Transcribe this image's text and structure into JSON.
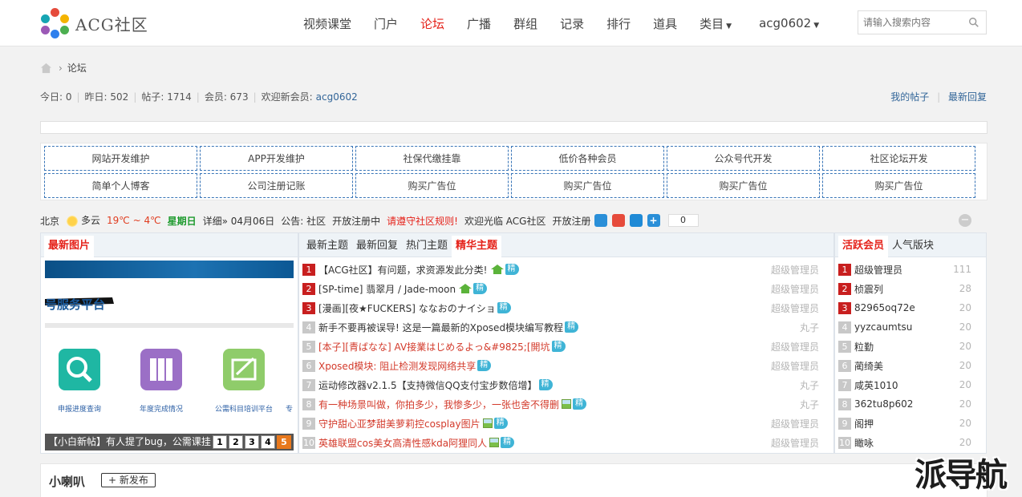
{
  "header": {
    "brand": "ACG社区",
    "nav": [
      {
        "label": "视频课堂",
        "active": false
      },
      {
        "label": "门户",
        "active": false
      },
      {
        "label": "论坛",
        "active": true
      },
      {
        "label": "广播",
        "active": false
      },
      {
        "label": "群组",
        "active": false
      },
      {
        "label": "记录",
        "active": false
      },
      {
        "label": "排行",
        "active": false
      },
      {
        "label": "道具",
        "active": false
      }
    ],
    "category_label": "类目",
    "user_label": "acg0602",
    "search_placeholder": "请输入搜索内容"
  },
  "breadcrumb": {
    "current": "论坛"
  },
  "stats": {
    "today": "今日: 0",
    "yesterday": "昨日: 502",
    "posts": "帖子: 1714",
    "members": "会员: 673",
    "welcome_prefix": "欢迎新会员:",
    "new_member": "acg0602",
    "my_posts": "我的帖子",
    "latest_replies": "最新回复"
  },
  "ads": [
    "网站开发维护",
    "APP开发维护",
    "社保代缴挂靠",
    "低价各种会员",
    "公众号代开发",
    "社区论坛开发",
    "简单个人博客",
    "公司注册记账",
    "购买广告位",
    "购买广告位",
    "购买广告位",
    "购买广告位"
  ],
  "strip": {
    "city": "北京",
    "weather": "多云",
    "temp": "19℃ ~ 4℃",
    "weekday": "星期日",
    "detail": "详细» 04月06日",
    "notice_label": "公告: 社区",
    "notice_1": "开放注册中",
    "notice_2": "请遵守社区规则!",
    "notice_3": "欢迎光临 ACG社区",
    "notice_4": "开放注册",
    "count": "0",
    "collapse": "−"
  },
  "left_panel": {
    "tab": "最新图片",
    "slide_text": "号服务平台",
    "apps": [
      {
        "label": "申报进度查询",
        "color": "#1fb7a3"
      },
      {
        "label": "年度完成情况",
        "color": "#9b6fc6"
      },
      {
        "label": "公需科目培训平台",
        "color": "#8fcc6a"
      }
    ],
    "apps_more": "专",
    "caption": "【小白新帖】有人提了bug，公需课挂",
    "pages": [
      "1",
      "2",
      "3",
      "4",
      "5"
    ]
  },
  "mid_panel": {
    "tabs": [
      {
        "label": "最新主题",
        "on": false
      },
      {
        "label": "最新回复",
        "on": false
      },
      {
        "label": "热门主题",
        "on": false
      },
      {
        "label": "精华主题",
        "on": true
      }
    ],
    "jing_label": "精",
    "threads": [
      {
        "rank": "1",
        "title": "【ACG社区】有问题，求资源发此分类!",
        "red": false,
        "hot": true,
        "img": false,
        "author": "超级管理员"
      },
      {
        "rank": "2",
        "title": "[SP-time] 翡翠月 / Jade-moon",
        "red": false,
        "hot": true,
        "img": false,
        "author": "超级管理员"
      },
      {
        "rank": "3",
        "title": "[漫画][夜★FUCKERS] ななおのナイショ",
        "red": false,
        "hot": false,
        "img": false,
        "author": "超级管理员"
      },
      {
        "rank": "4",
        "title": "新手不要再被误导! 这是一篇最新的Xposed模块编写教程",
        "red": false,
        "hot": false,
        "img": false,
        "author": "丸子"
      },
      {
        "rank": "5",
        "title": "[本子][青ばなな] AV接業はじめるよっ&#9825;[開坑",
        "red": true,
        "hot": false,
        "img": false,
        "author": "超级管理员"
      },
      {
        "rank": "6",
        "title": "Xposed模块: 阻止检测发现网络共享",
        "red": true,
        "hot": false,
        "img": false,
        "author": "超级管理员"
      },
      {
        "rank": "7",
        "title": "运动修改器v2.1.5【支持微信QQ支付宝步数倍增】",
        "red": false,
        "hot": false,
        "img": false,
        "author": "丸子"
      },
      {
        "rank": "8",
        "title": "有一种场景叫做，你拍多少，我惨多少，一张也舍不得删",
        "red": true,
        "hot": false,
        "img": true,
        "author": "丸子"
      },
      {
        "rank": "9",
        "title": "守护甜心亚梦甜美萝莉控cosplay图片",
        "red": true,
        "hot": false,
        "img": true,
        "author": "超级管理员"
      },
      {
        "rank": "10",
        "title": "英雄联盟cos美女高清性感kda阿狸同人",
        "red": true,
        "hot": false,
        "img": true,
        "author": "超级管理员"
      }
    ]
  },
  "right_panel": {
    "tabs": [
      {
        "label": "活跃会员",
        "on": true
      },
      {
        "label": "人气版块",
        "on": false
      }
    ],
    "members": [
      {
        "rank": "1",
        "name": "超级管理员",
        "count": "111"
      },
      {
        "rank": "2",
        "name": "桢震列",
        "count": "28"
      },
      {
        "rank": "3",
        "name": "82965oq72e",
        "count": "20"
      },
      {
        "rank": "4",
        "name": "yyzcaumtsu",
        "count": "20"
      },
      {
        "rank": "5",
        "name": "粒勤",
        "count": "20"
      },
      {
        "rank": "6",
        "name": "蔺绮美",
        "count": "20"
      },
      {
        "rank": "7",
        "name": "咸英1010",
        "count": "20"
      },
      {
        "rank": "8",
        "name": "362tu8p602",
        "count": "20"
      },
      {
        "rank": "9",
        "name": "阁押",
        "count": "20"
      },
      {
        "rank": "10",
        "name": "瞰咏",
        "count": "20"
      }
    ]
  },
  "bottom": {
    "title": "小喇叭",
    "publish": "新发布"
  },
  "watermark": "派导航",
  "colors": {
    "accent_red": "#e5231b",
    "link_blue": "#336699",
    "rank_top": "#c81f1f",
    "rank_other": "#c8c8c8",
    "jing_badge": "#3fb4d6"
  }
}
